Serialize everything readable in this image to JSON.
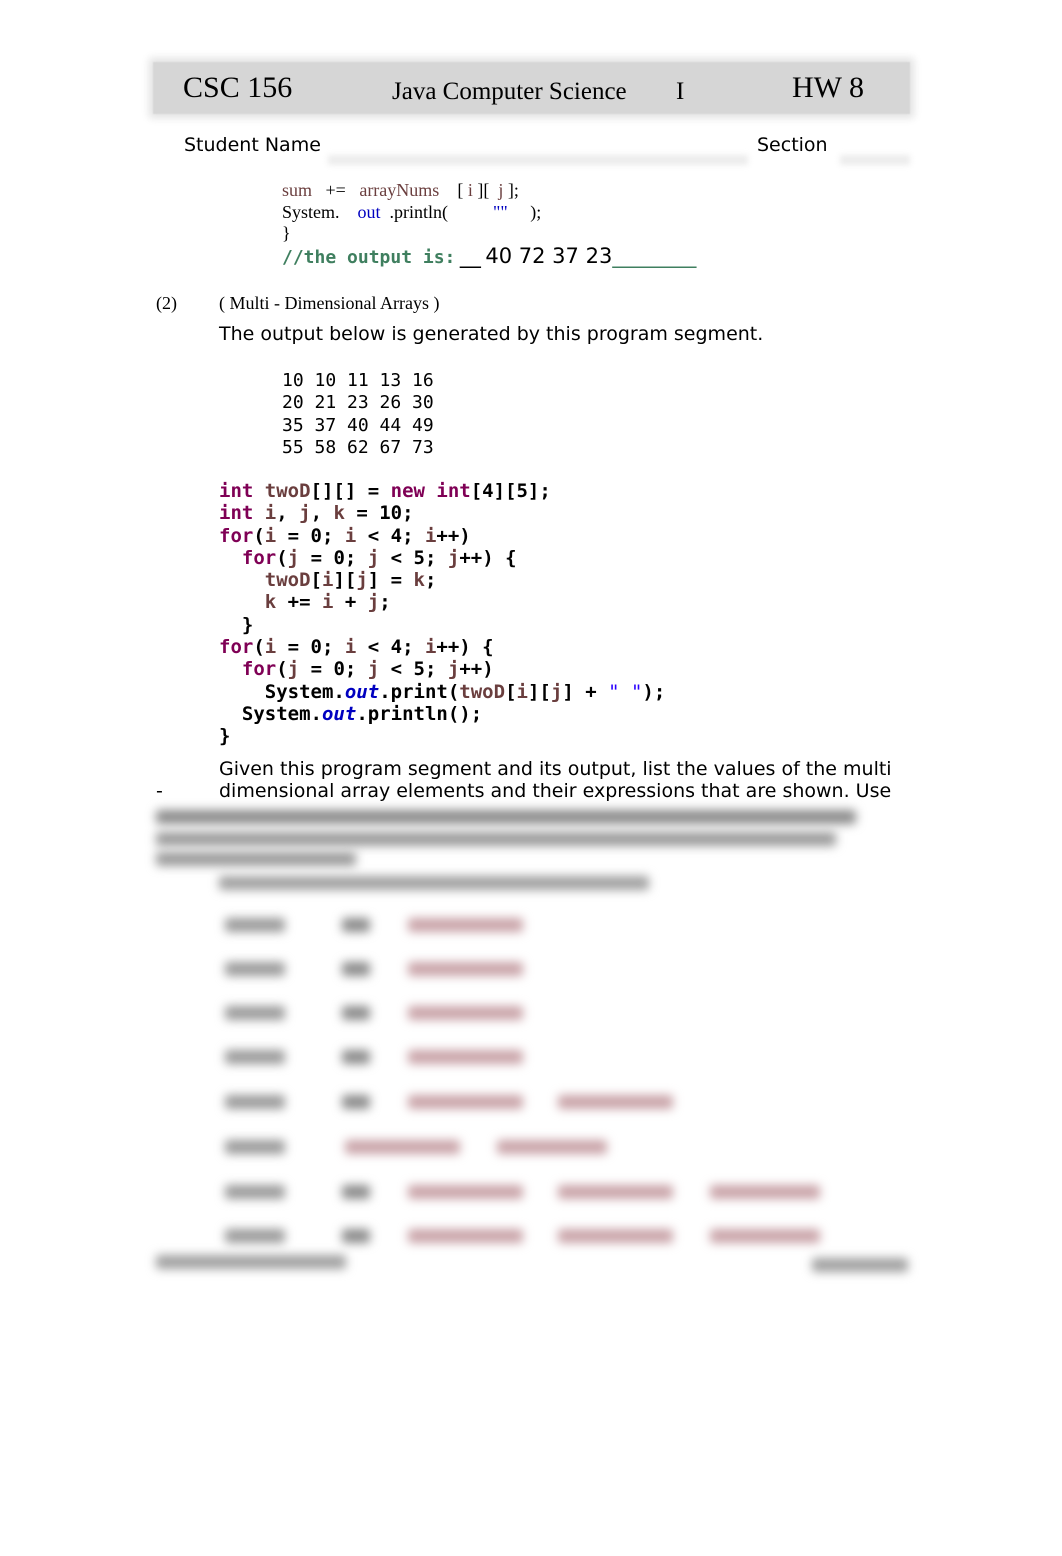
{
  "header": {
    "course": "CSC 156",
    "title": "Java Computer Science",
    "level": "I",
    "homework": "HW 8"
  },
  "student": {
    "name_label": "Student Name",
    "section_label": "Section",
    "name_value": "",
    "section_value": ""
  },
  "problem1_tail": {
    "line1": {
      "sum": "sum",
      "op": "+=",
      "array": "arrayNums",
      "open": "[",
      "i": "i",
      "mid": "][",
      "j": "j",
      "close": "];"
    },
    "line2": {
      "system": "System.",
      "out": "out",
      "println": ".println(",
      "str": "\"\"",
      "end": ");"
    },
    "line3": "}",
    "output_comment": "//the output is:",
    "output_prefix": "__",
    "output_value": "40 72 37 23",
    "output_suffix": "________"
  },
  "problem2": {
    "number": "(2)",
    "topic": "( Multi - Dimensional Arrays )",
    "intro": "The output below is generated by this program segment.",
    "output_rows": [
      "10 10 11 13 16",
      "20 21 23 26 30",
      "35 37 40 44 49",
      "55 58 62 67 73"
    ],
    "code_lines": [
      "int twoD[][] = new int[4][5];",
      "int i, j, k = 10;",
      "for(i = 0; i < 4; i++)",
      "  for(j = 0; j < 5; j++) {",
      "    twoD[i][j] = k;",
      "    k += i + j;",
      "  }",
      "for(i = 0; i < 4; i++) {",
      "  for(j = 0; j < 5; j++)",
      "    System.out.print(twoD[i][j] + \" \");",
      "  System.out.println();",
      "}"
    ],
    "question_line1": "Given this program segment and its output, list the values of the multi",
    "question_dash": "-",
    "question_line2": "dimensional array elements and their expressions that are shown.  Use"
  },
  "colors": {
    "keyword": "#7f0055",
    "variable": "#6a3e3e",
    "field": "#0000c0",
    "string": "#2a00ff",
    "comment": "#3f7f5f",
    "header_bg": "#d6d6d6"
  }
}
